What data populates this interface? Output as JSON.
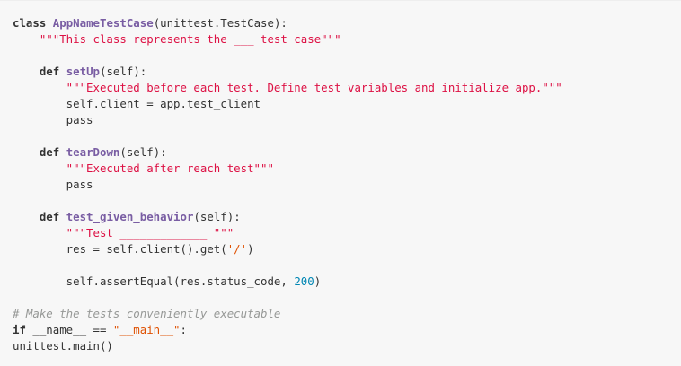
{
  "code": {
    "l1": [
      "class",
      " ",
      "AppNameTestCase",
      "(unittest.TestCase):"
    ],
    "l2": "    \"\"\"This class represents the ___ test case\"\"\"",
    "l4": [
      "    ",
      "def",
      " ",
      "setUp",
      "(self):"
    ],
    "l5": "        \"\"\"Executed before each test. Define test variables and initialize app.\"\"\"",
    "l6": "        self.client = app.test_client",
    "l7": "        pass",
    "l9": [
      "    ",
      "def",
      " ",
      "tearDown",
      "(self):"
    ],
    "l10": "        \"\"\"Executed after reach test\"\"\"",
    "l11": "        pass",
    "l13": [
      "    ",
      "def",
      " ",
      "test_given_behavior",
      "(self):"
    ],
    "l14": "        \"\"\"Test _____________ \"\"\"",
    "l15": [
      "        res = self.client().get(",
      "'/'",
      ")"
    ],
    "l17": [
      "        self.assertEqual(res.status_code, ",
      "200",
      ")"
    ],
    "l19": "# Make the tests conveniently executable",
    "l20": [
      "if",
      " __name__ == ",
      "\"__main__\"",
      ":"
    ],
    "l21": "unittest.main()"
  }
}
